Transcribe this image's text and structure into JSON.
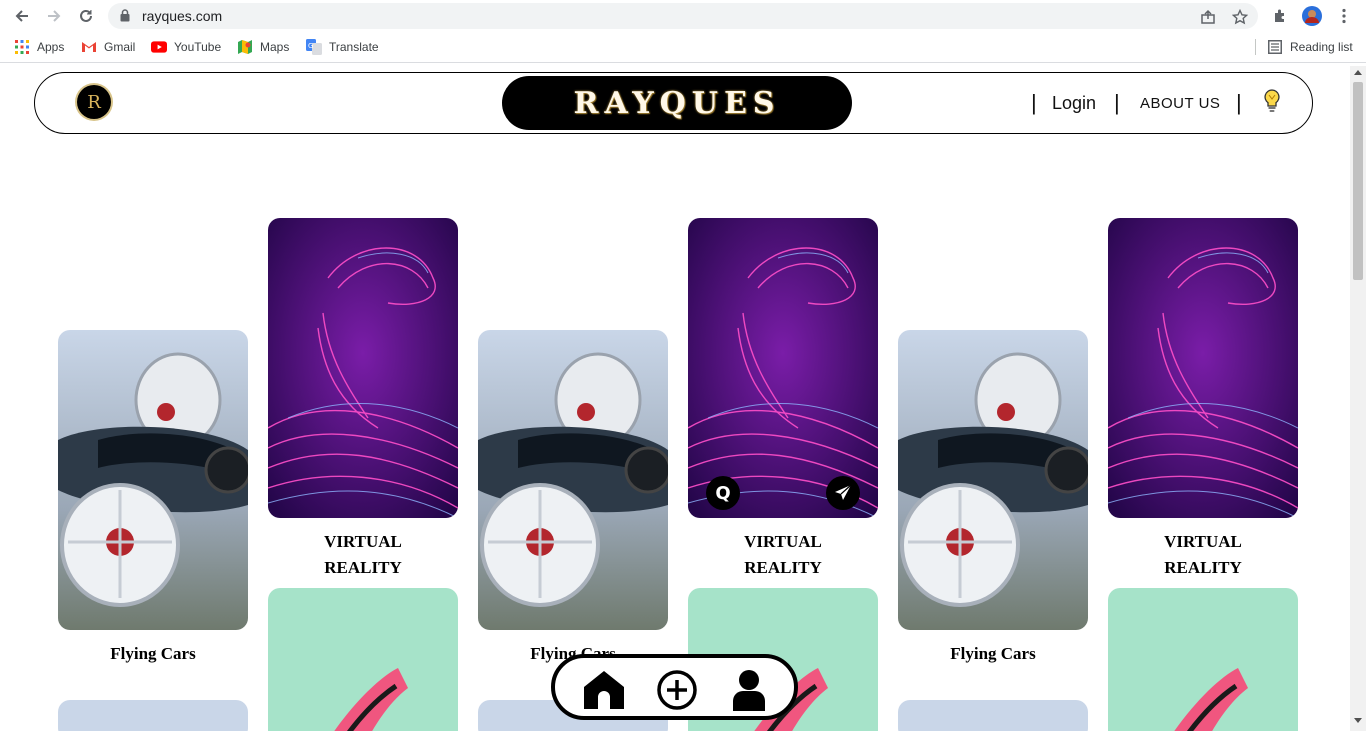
{
  "browser": {
    "url": "rayques.com",
    "bookmarks": [
      {
        "label": "Apps",
        "icon": "apps-grid-icon"
      },
      {
        "label": "Gmail",
        "icon": "gmail-icon"
      },
      {
        "label": "YouTube",
        "icon": "youtube-icon"
      },
      {
        "label": "Maps",
        "icon": "maps-icon"
      },
      {
        "label": "Translate",
        "icon": "translate-icon"
      }
    ],
    "reading_list": "Reading list"
  },
  "header": {
    "logo_letter": "R",
    "brand": "RAYQUES",
    "nav": {
      "login": "Login",
      "about": "ABOUT US",
      "separator": "|"
    }
  },
  "cards": {
    "flying_cars": "Flying Cars",
    "vr_line1": "VIRTUAL",
    "vr_line2": "REALITY",
    "overlay_q": "Q"
  },
  "colors": {
    "brand_bg": "#000000",
    "vr_purple": "#4b0a6e",
    "mint": "#a6e3c9",
    "heel_pink": "#f0567f"
  }
}
